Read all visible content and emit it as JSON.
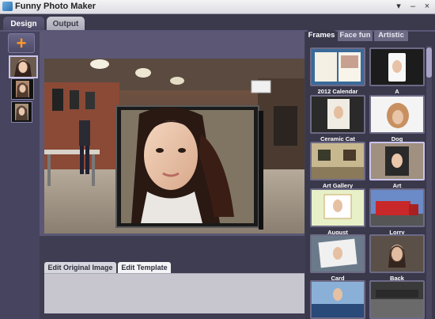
{
  "window": {
    "title": "Funny Photo Maker",
    "controls": [
      "▾",
      "–",
      "×"
    ]
  },
  "main_tabs": [
    {
      "label": "Design"
    },
    {
      "label": "Output"
    }
  ],
  "left": {
    "add_symbol": "+"
  },
  "edit_tabs": [
    {
      "label": "Edit Original Image"
    },
    {
      "label": "Edit Template"
    }
  ],
  "right_tabs": [
    {
      "label": "Frames"
    },
    {
      "label": "Face fun"
    },
    {
      "label": "Artistic"
    }
  ],
  "templates": [
    {
      "label": "2012 Calendar"
    },
    {
      "label": "A"
    },
    {
      "label": "Ceramic Cat"
    },
    {
      "label": "Dog"
    },
    {
      "label": "Art Gallery"
    },
    {
      "label": "Art"
    },
    {
      "label": "August"
    },
    {
      "label": "Lorry"
    },
    {
      "label": "Card"
    },
    {
      "label": "Back"
    },
    {
      "label": ""
    },
    {
      "label": ""
    }
  ],
  "colors": {
    "accent": "#ff9a28",
    "panel": "#3f3d51"
  }
}
